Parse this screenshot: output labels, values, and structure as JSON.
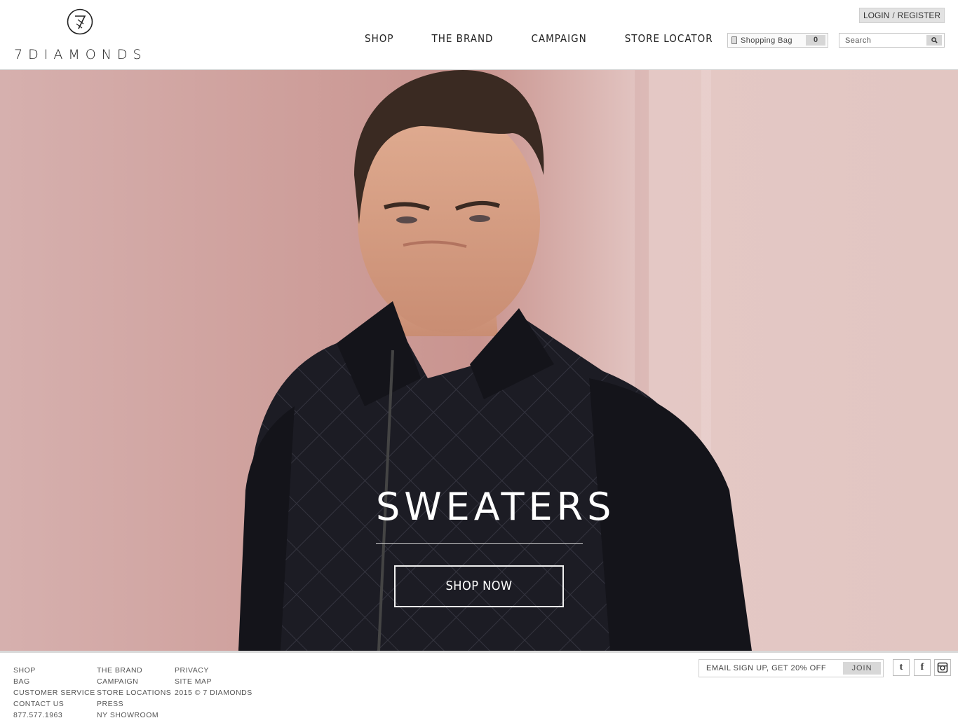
{
  "brand": {
    "name": "7DIAMONDS",
    "logo_icon": "seven-diamond-logo-icon"
  },
  "nav": {
    "items": [
      "SHOP",
      "THE BRAND",
      "CAMPAIGN",
      "STORE LOCATOR"
    ]
  },
  "account": {
    "login": "LOGIN",
    "separator": "/",
    "register": "REGISTER"
  },
  "bag": {
    "label": "Shopping Bag",
    "count": "0",
    "icon": "shopping-bag-icon"
  },
  "search": {
    "placeholder": "Search",
    "icon": "search-icon"
  },
  "hero": {
    "title": "SWEATERS",
    "cta": "SHOP NOW",
    "image": "man-in-quilted-black-sweater-jacket-against-pink-wall"
  },
  "footer": {
    "col1": [
      "SHOP",
      "BAG",
      "CUSTOMER SERVICE",
      "CONTACT US",
      "877.577.1963"
    ],
    "col2": [
      "THE BRAND",
      "CAMPAIGN",
      "STORE LOCATIONS",
      "PRESS",
      "NY SHOWROOM"
    ],
    "col3": [
      "PRIVACY",
      "SITE MAP",
      "2015 © 7 DIAMONDS"
    ],
    "email_placeholder": "EMAIL SIGN UP, GET 20% OFF",
    "join": "JOIN",
    "social": [
      {
        "icon": "tumblr-icon",
        "glyph": "t"
      },
      {
        "icon": "facebook-icon",
        "glyph": "f"
      },
      {
        "icon": "instagram-icon",
        "glyph": ""
      }
    ]
  },
  "colors": {
    "accent_gray": "#d8d8d8",
    "hero_wall": "#d8b3b1",
    "jacket": "#1b1b22"
  }
}
